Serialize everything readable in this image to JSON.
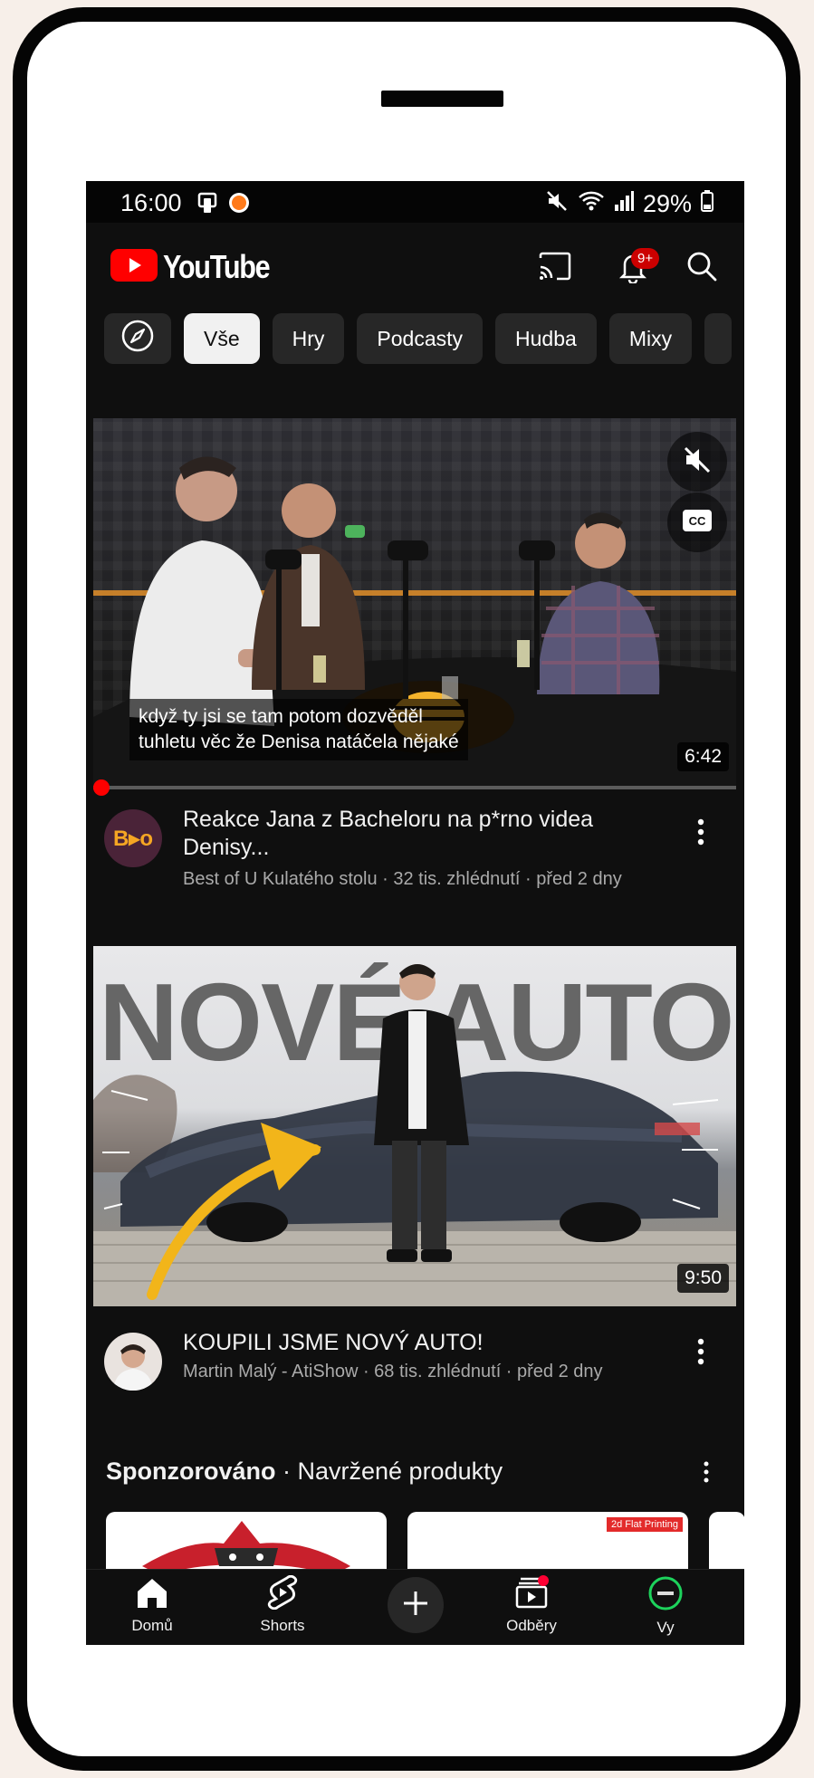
{
  "status_bar": {
    "time": "16:00",
    "battery": "29%",
    "icons": [
      "screenshot-icon",
      "app-notification-icon",
      "mute-icon",
      "wifi-icon",
      "signal-icon",
      "battery-icon"
    ]
  },
  "header": {
    "logo_text": "YouTube",
    "notification_badge": "9+",
    "icons": [
      "cast-icon",
      "bell-icon",
      "search-icon"
    ]
  },
  "chips": [
    {
      "label": "Vše",
      "selected": true
    },
    {
      "label": "Hry",
      "selected": false
    },
    {
      "label": "Podcasty",
      "selected": false
    },
    {
      "label": "Hudba",
      "selected": false
    },
    {
      "label": "Mixy",
      "selected": false
    }
  ],
  "videos": [
    {
      "caption_line1": "když ty jsi se tam potom dozvěděl",
      "caption_line2": "tuhletu věc že Denisa natáčela nějaké",
      "duration": "6:42",
      "title": "Reakce Jana z Bacheloru na p*rno videa Denisy...",
      "channel_avatar_text": "B▸o",
      "subtitle": "Best of U Kulatého stolu · 32 tis. zhlédnutí · před 2 dny",
      "muted": true,
      "captions_on": true
    },
    {
      "thumbnail_text": "NOVÉ AUTO",
      "duration": "9:50",
      "title": "KOUPILI JSME NOVÝ AUTO!",
      "subtitle": "Martin Malý - AtiShow · 68 tis. zhlédnutí · před 2 dny"
    }
  ],
  "sponsored": {
    "label_bold": "Sponzorováno",
    "label_rest": " · Navržené produkty",
    "card2_badge": "2d Flat Printing"
  },
  "bottom_nav": {
    "home": "Domů",
    "shorts": "Shorts",
    "subscriptions": "Odběry",
    "you": "Vy"
  },
  "colors": {
    "background": "#0f0f0f",
    "brand_red": "#ff0000",
    "chip_bg": "#272727",
    "chip_selected_bg": "#f1f1f1",
    "secondary_text": "#aaaaaa",
    "frame": "#050505"
  }
}
